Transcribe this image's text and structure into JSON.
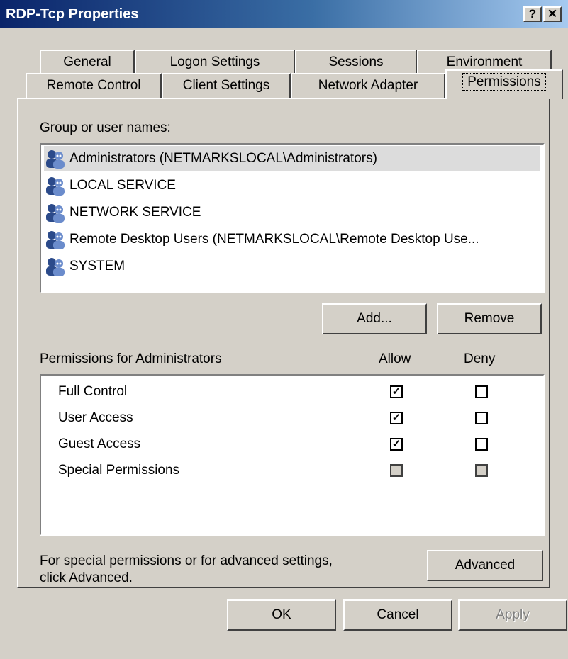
{
  "window": {
    "title": "RDP-Tcp Properties",
    "help_label": "?",
    "close_label": "✕"
  },
  "tabs": {
    "row1": [
      "General",
      "Logon Settings",
      "Sessions",
      "Environment"
    ],
    "row2": [
      "Remote Control",
      "Client Settings",
      "Network Adapter",
      "Permissions"
    ]
  },
  "group_label": "Group or user names:",
  "users": [
    "Administrators (NETMARKSLOCAL\\Administrators)",
    "LOCAL SERVICE",
    "NETWORK SERVICE",
    "Remote Desktop Users (NETMARKSLOCAL\\Remote Desktop Use...",
    "SYSTEM"
  ],
  "user_icon": "user-group-icon",
  "buttons": {
    "add": "Add...",
    "remove": "Remove",
    "advanced": "Advanced",
    "ok": "OK",
    "cancel": "Cancel",
    "apply": "Apply"
  },
  "permissions": {
    "header": "Permissions for Administrators",
    "allow_label": "Allow",
    "deny_label": "Deny",
    "rows": [
      {
        "name": "Full Control",
        "allow": true,
        "deny": false,
        "disabled": false
      },
      {
        "name": "User Access",
        "allow": true,
        "deny": false,
        "disabled": false
      },
      {
        "name": "Guest Access",
        "allow": true,
        "deny": false,
        "disabled": false
      },
      {
        "name": "Special Permissions",
        "allow": false,
        "deny": false,
        "disabled": true
      }
    ]
  },
  "advanced_note": {
    "line1": "For special permissions or for advanced settings,",
    "line2": "click Advanced."
  }
}
